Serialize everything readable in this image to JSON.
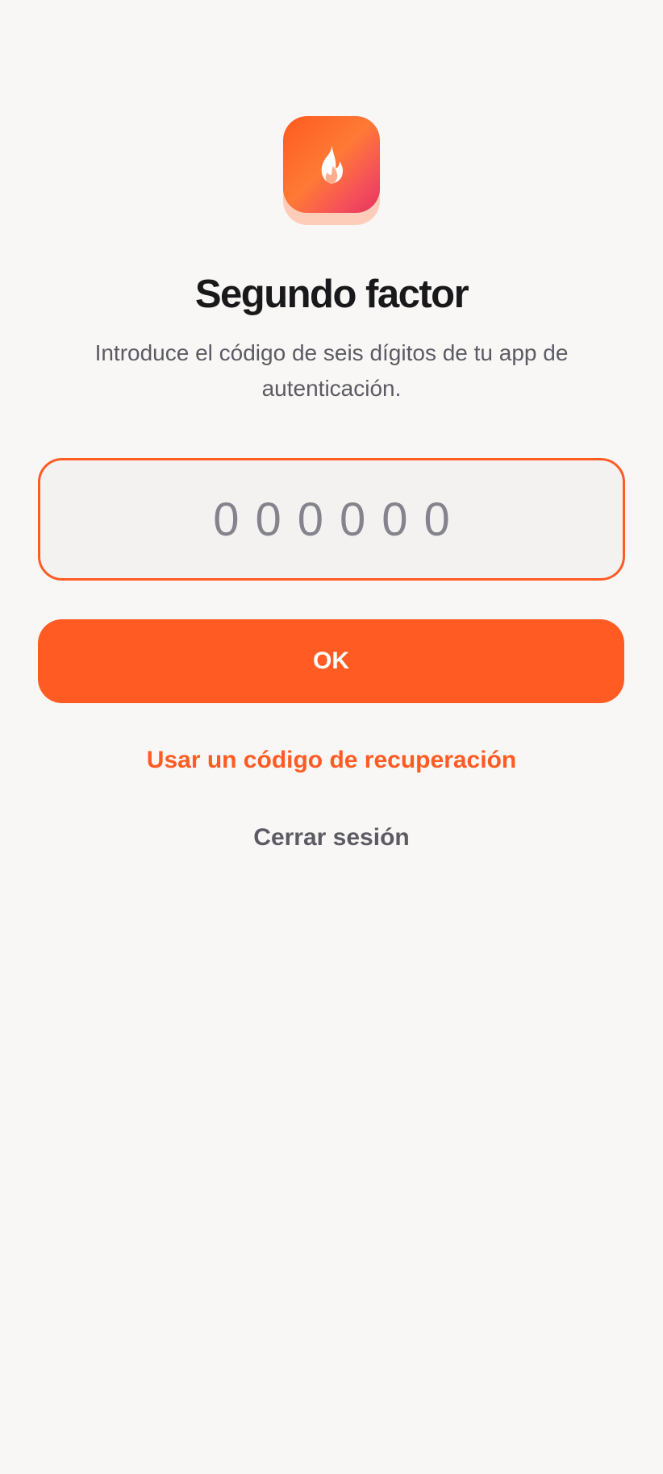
{
  "logo": {
    "icon": "flame-icon",
    "colors": [
      "#ff5a1f",
      "#ff7a35",
      "#e6335f"
    ]
  },
  "title": "Segundo factor",
  "subtitle": "Introduce el código de seis dígitos de tu app de autenticación.",
  "code_field": {
    "value": "",
    "placeholder": "000000"
  },
  "ok_label": "OK",
  "recovery_label": "Usar un código de recuperación",
  "logout_label": "Cerrar sesión",
  "colors": {
    "accent": "#ff5b22",
    "background": "#f9f7f6",
    "title": "#19191b",
    "muted": "#5c5b63"
  }
}
